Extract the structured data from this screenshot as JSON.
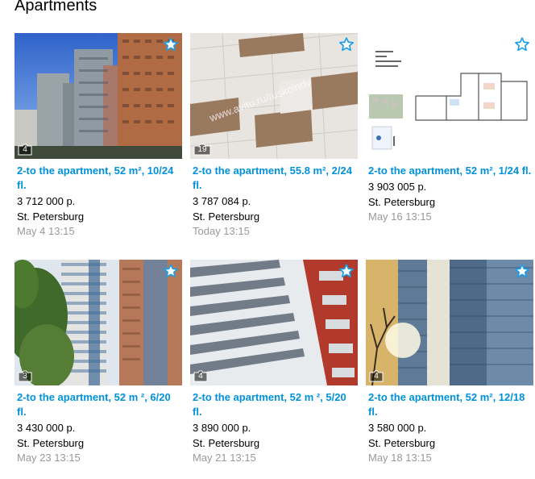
{
  "section": {
    "title": "Apartments"
  },
  "listings": [
    {
      "title": "2-to the apartment, 52 m², 10/24 fl.",
      "price": "3 712 000 р.",
      "city": "St. Petersburg",
      "date": "May 4 13:15",
      "photo_count": "4"
    },
    {
      "title": "2-to the apartment, 55.8 m², 2/24 fl.",
      "price": "3 787 084 р.",
      "city": "St. Petersburg",
      "date": "Today 13:15",
      "photo_count": "19",
      "watermark": "www.avito.ru/ruskolndv"
    },
    {
      "title": "2-to the apartment, 52 m², 1/24 fl.",
      "price": "3 903 005 р.",
      "city": "St. Petersburg",
      "date": "May 16 13:15"
    },
    {
      "title": "2-to the apartment, 52 m ², 6/20 fl.",
      "price": "3 430 000 р.",
      "city": "St. Petersburg",
      "date": "May 23 13:15",
      "photo_count": "3"
    },
    {
      "title": "2-to the apartment, 52 m ², 5/20 fl.",
      "price": "3 890 000 р.",
      "city": "St. Petersburg",
      "date": "May 21 13:15",
      "photo_count": "4"
    },
    {
      "title": "2-to the apartment, 52 m², 12/18 fl.",
      "price": "3 580 000 р.",
      "city": "St. Petersburg",
      "date": "May 18 13:15",
      "photo_count": "4"
    }
  ],
  "icons": {
    "favorite": "star-outline-icon",
    "photos": "camera-icon"
  },
  "colors": {
    "link": "#0091d9",
    "muted": "#999999",
    "star": "#1a9ee8"
  }
}
